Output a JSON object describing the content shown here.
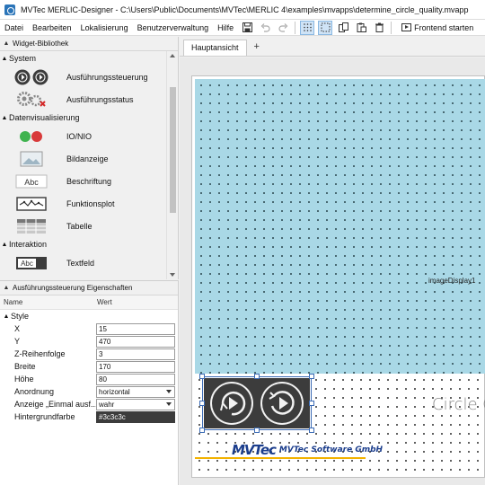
{
  "window": {
    "title": "MVTec MERLIC-Designer - C:\\Users\\Public\\Documents\\MVTec\\MERLIC 4\\examples\\mvapps\\determine_circle_quality.mvapp"
  },
  "menu": {
    "items": [
      "Datei",
      "Bearbeiten",
      "Lokalisierung",
      "Benutzerverwaltung",
      "Hilfe"
    ],
    "frontend_label": "Frontend starten"
  },
  "widget_library": {
    "title": "Widget-Bibliothek",
    "categories": [
      {
        "name": "System",
        "items": [
          "Ausführungssteuerung",
          "Ausführungsstatus"
        ]
      },
      {
        "name": "Datenvisualisierung",
        "items": [
          "IO/NIO",
          "Bildanzeige",
          "Beschriftung",
          "Funktionsplot",
          "Tabelle"
        ]
      },
      {
        "name": "Interaktion",
        "items": [
          "Textfeld"
        ]
      }
    ],
    "icon_text_abc": "Abc"
  },
  "properties": {
    "title": "Ausführungssteuerung Eigenschaften",
    "col_name": "Name",
    "col_value": "Wert",
    "group": "Style",
    "rows": [
      {
        "name": "X",
        "value": "15"
      },
      {
        "name": "Y",
        "value": "470"
      },
      {
        "name": "Z-Reihenfolge",
        "value": "3"
      },
      {
        "name": "Breite",
        "value": "170"
      },
      {
        "name": "Höhe",
        "value": "80"
      },
      {
        "name": "Anordnung",
        "value": "horizontal"
      },
      {
        "name": "Anzeige „Einmal ausf...",
        "value": "wahr"
      },
      {
        "name": "Hintergrundfarbe",
        "value": "#3c3c3c"
      }
    ]
  },
  "tabs": {
    "main": "Hauptansicht",
    "add": "+"
  },
  "canvas": {
    "image_display_label": "imageDisplay1",
    "circle_label": "Circle Q",
    "logo_mark": "MVTec",
    "logo_text": "MVTec Software GmbH"
  },
  "colors": {
    "image_display_bg": "#a9d8e6",
    "control_bg": "#3c3c3c",
    "selection": "#3b6bb5",
    "brand_blue": "#1b3d8c",
    "brand_yellow": "#f2b200"
  }
}
